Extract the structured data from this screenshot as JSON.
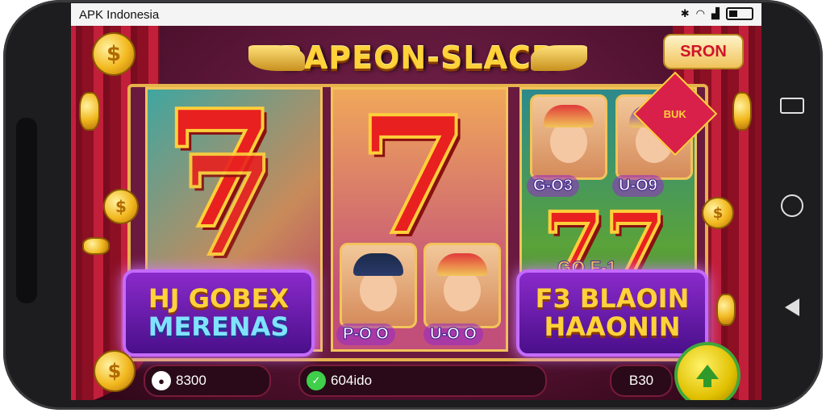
{
  "status_bar": {
    "carrier": "APK Indonesia",
    "icons": [
      "bluetooth-icon",
      "wifi-icon",
      "signal-icon",
      "battery-icon"
    ]
  },
  "game": {
    "title": "BAPEON-SLACR",
    "spin_button": "SRON",
    "reels": [
      {
        "symbol": "7",
        "panel_lines": [
          "HJ GOBEX",
          "MERENAS"
        ]
      },
      {
        "symbol": "7",
        "portrait_labels": [
          "P-O O",
          "U-O O"
        ]
      },
      {
        "symbol": "77",
        "top_labels": [
          "G-O3",
          "U-O9"
        ],
        "mid_label": "GO F-1",
        "panel_lines": [
          "F3 BLAOIN",
          "HAAONIN"
        ]
      }
    ],
    "corner_ribbon": "BUK"
  },
  "bottom_bar": {
    "balance": "8300",
    "bet_label": "604ido",
    "win": "B30"
  },
  "colors": {
    "accent_gold": "#ffd23a",
    "curtain_red": "#c21f3a",
    "panel_purple": "#8a2acb",
    "play_green": "#3fa83a"
  }
}
